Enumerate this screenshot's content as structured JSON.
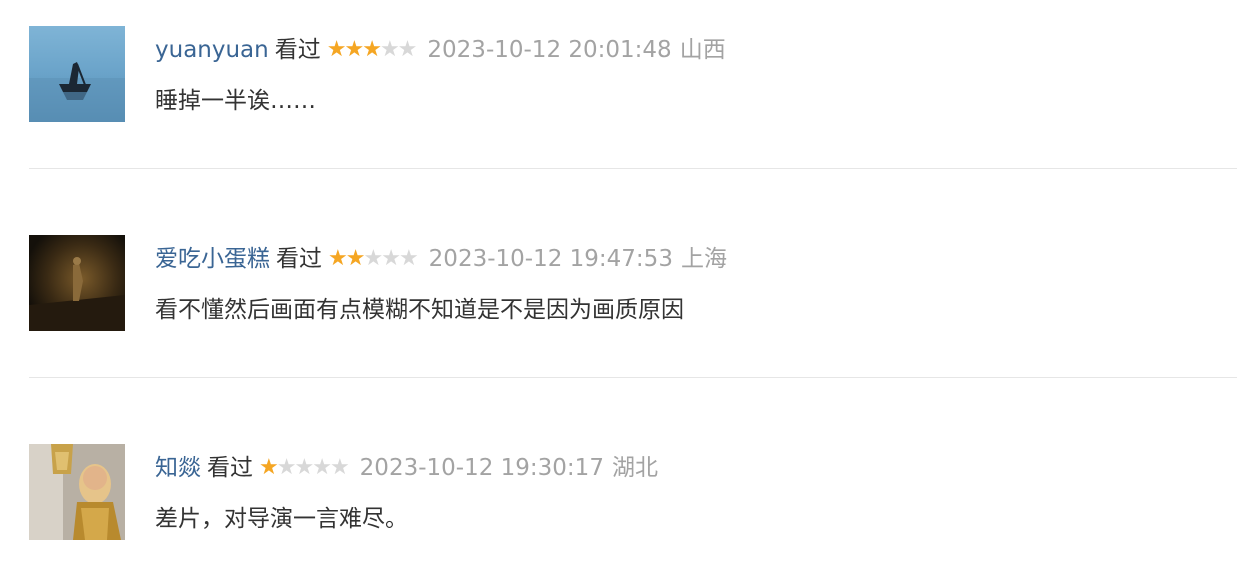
{
  "comments": [
    {
      "user": "yuanyuan",
      "status": "看过",
      "rating": 3,
      "rating_max": 5,
      "time": "2023-10-12 20:01:48",
      "location": "山西",
      "content": "睡掉一半诶……"
    },
    {
      "user": "爱吃小蛋糕",
      "status": "看过",
      "rating": 2,
      "rating_max": 5,
      "time": "2023-10-12 19:47:53",
      "location": "上海",
      "content": "看不懂然后画面有点模糊不知道是不是因为画质原因"
    },
    {
      "user": "知燚",
      "status": "看过",
      "rating": 1,
      "rating_max": 5,
      "time": "2023-10-12 19:30:17",
      "location": "湖北",
      "content": "差片，对导演一言难尽。"
    }
  ],
  "colors": {
    "username": "#3a6594",
    "star_on": "#f5a623",
    "star_off": "#d8d8d8",
    "meta_gray": "#a3a3a3",
    "text": "#333333",
    "divider": "#e6e6e6"
  }
}
